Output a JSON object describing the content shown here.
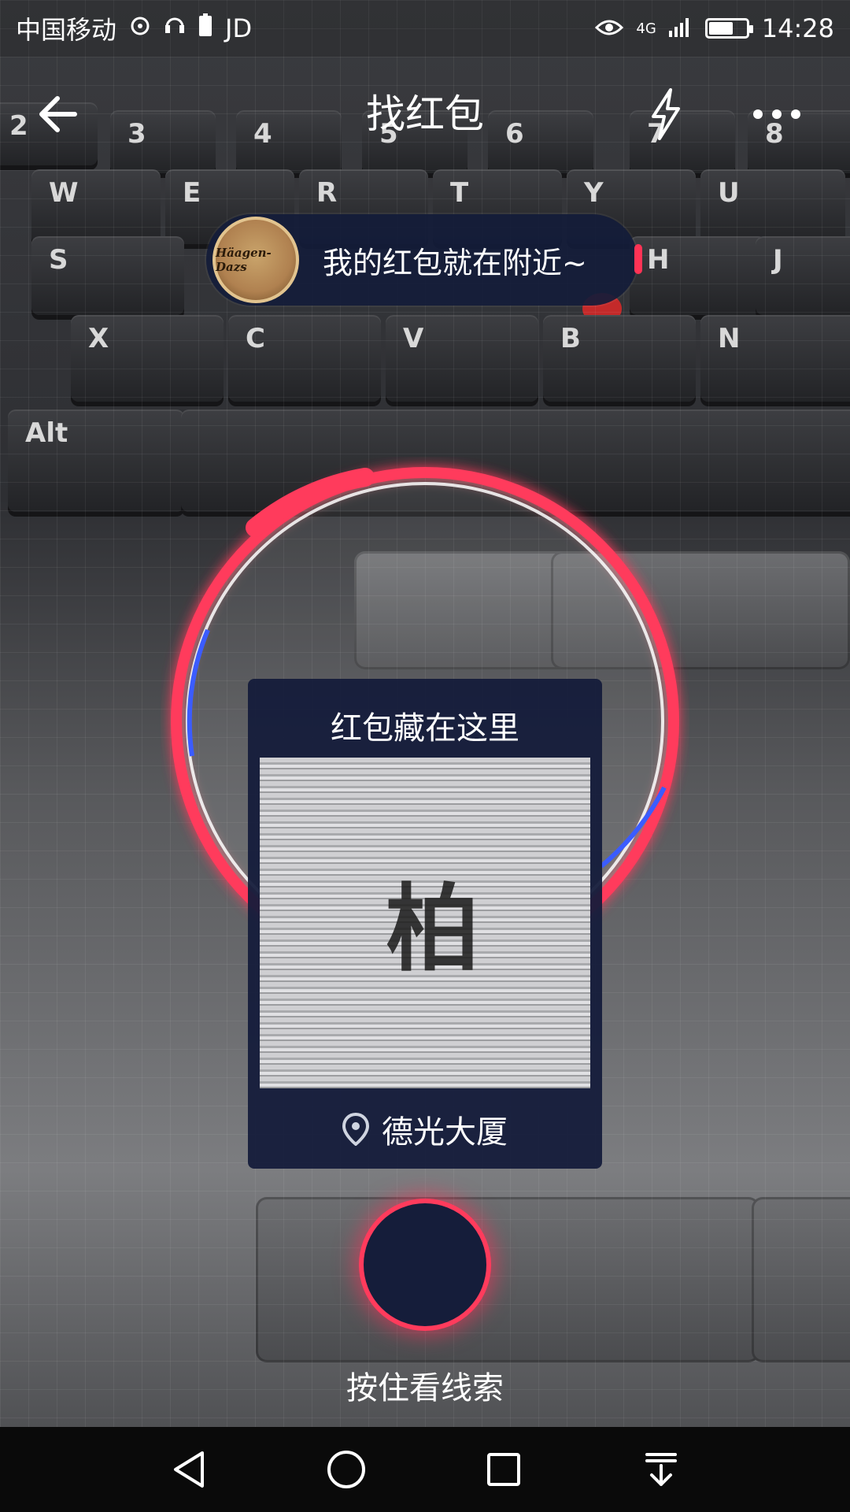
{
  "status_bar": {
    "carrier": "中国移动",
    "app_badge": "JD",
    "network": "4G",
    "time": "14:28"
  },
  "nav": {
    "title": "找红包",
    "back_icon": "arrow-left-icon",
    "flash_icon": "lightning-icon",
    "more_icon": "more-dots-icon"
  },
  "bubble": {
    "avatar_text": "Häagen-Dazs",
    "message": "我的红包就在附近~"
  },
  "clue_card": {
    "title": "红包藏在这里",
    "image_character": "柏",
    "location": "德光大厦"
  },
  "hold_button": {
    "label": "按住看线索"
  },
  "colors": {
    "accent_red": "#ff3b5c",
    "panel_navy": "#141c3a",
    "radar_blue": "#3b5cff"
  },
  "system_nav": [
    "back-triangle-icon",
    "home-circle-icon",
    "recents-square-icon",
    "notification-pull-icon"
  ]
}
